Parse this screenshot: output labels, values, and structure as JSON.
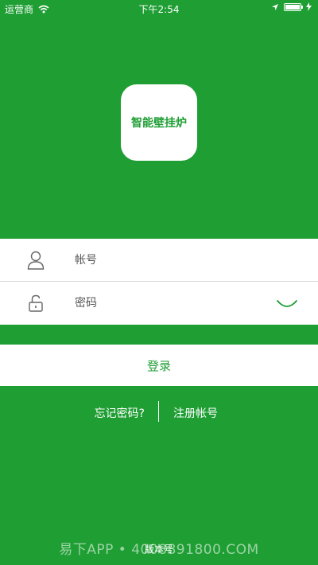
{
  "status_bar": {
    "carrier": "运营商",
    "time": "下午2:54",
    "wifi_icon": "wifi-icon",
    "location_icon": "location-arrow-icon",
    "battery_icon": "battery-icon",
    "charging_icon": "charging-icon"
  },
  "logo": {
    "text": "智能壁挂炉"
  },
  "form": {
    "account_placeholder": "帐号",
    "account_value": "",
    "password_placeholder": "密码",
    "password_value": "",
    "account_icon": "user-icon",
    "password_icon": "lock-icon",
    "loading_icon": "loading-spinner-icon"
  },
  "actions": {
    "login_label": "登录",
    "forgot_label": "忘记密码?",
    "register_label": "注册帐号"
  },
  "footer": {
    "version_label": "版本号",
    "watermark": "易下APP • 4008891800.COM"
  },
  "colors": {
    "brand_green": "#1f9e34",
    "white": "#ffffff"
  }
}
